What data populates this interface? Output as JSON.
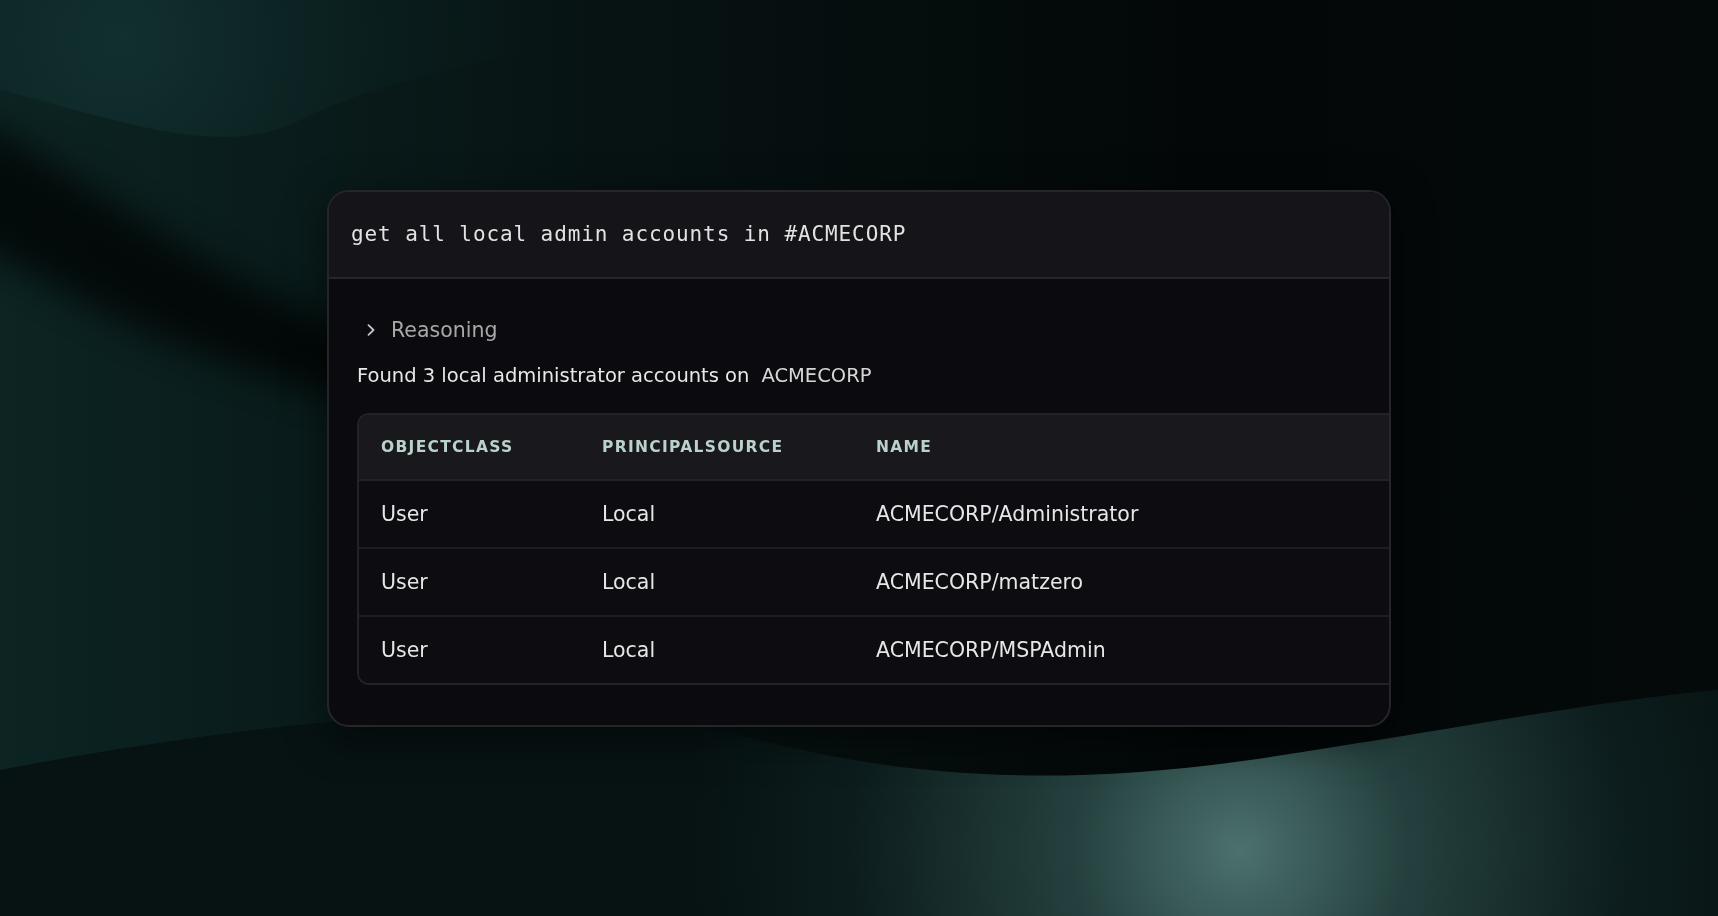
{
  "query": "get all local admin accounts in #ACMECORP",
  "reasoning": {
    "label": "Reasoning",
    "expanded": false
  },
  "summary": {
    "text": "Found 3 local administrator accounts on",
    "entity": "ACMECORP"
  },
  "table": {
    "columns": [
      "OBJECTCLASS",
      "PRINCIPALSOURCE",
      "NAME"
    ],
    "rows": [
      [
        "User",
        "Local",
        "ACMECORP/Administrator"
      ],
      [
        "User",
        "Local",
        "ACMECORP/matzero"
      ],
      [
        "User",
        "Local",
        "ACMECORP/MSPAdmin"
      ]
    ]
  }
}
